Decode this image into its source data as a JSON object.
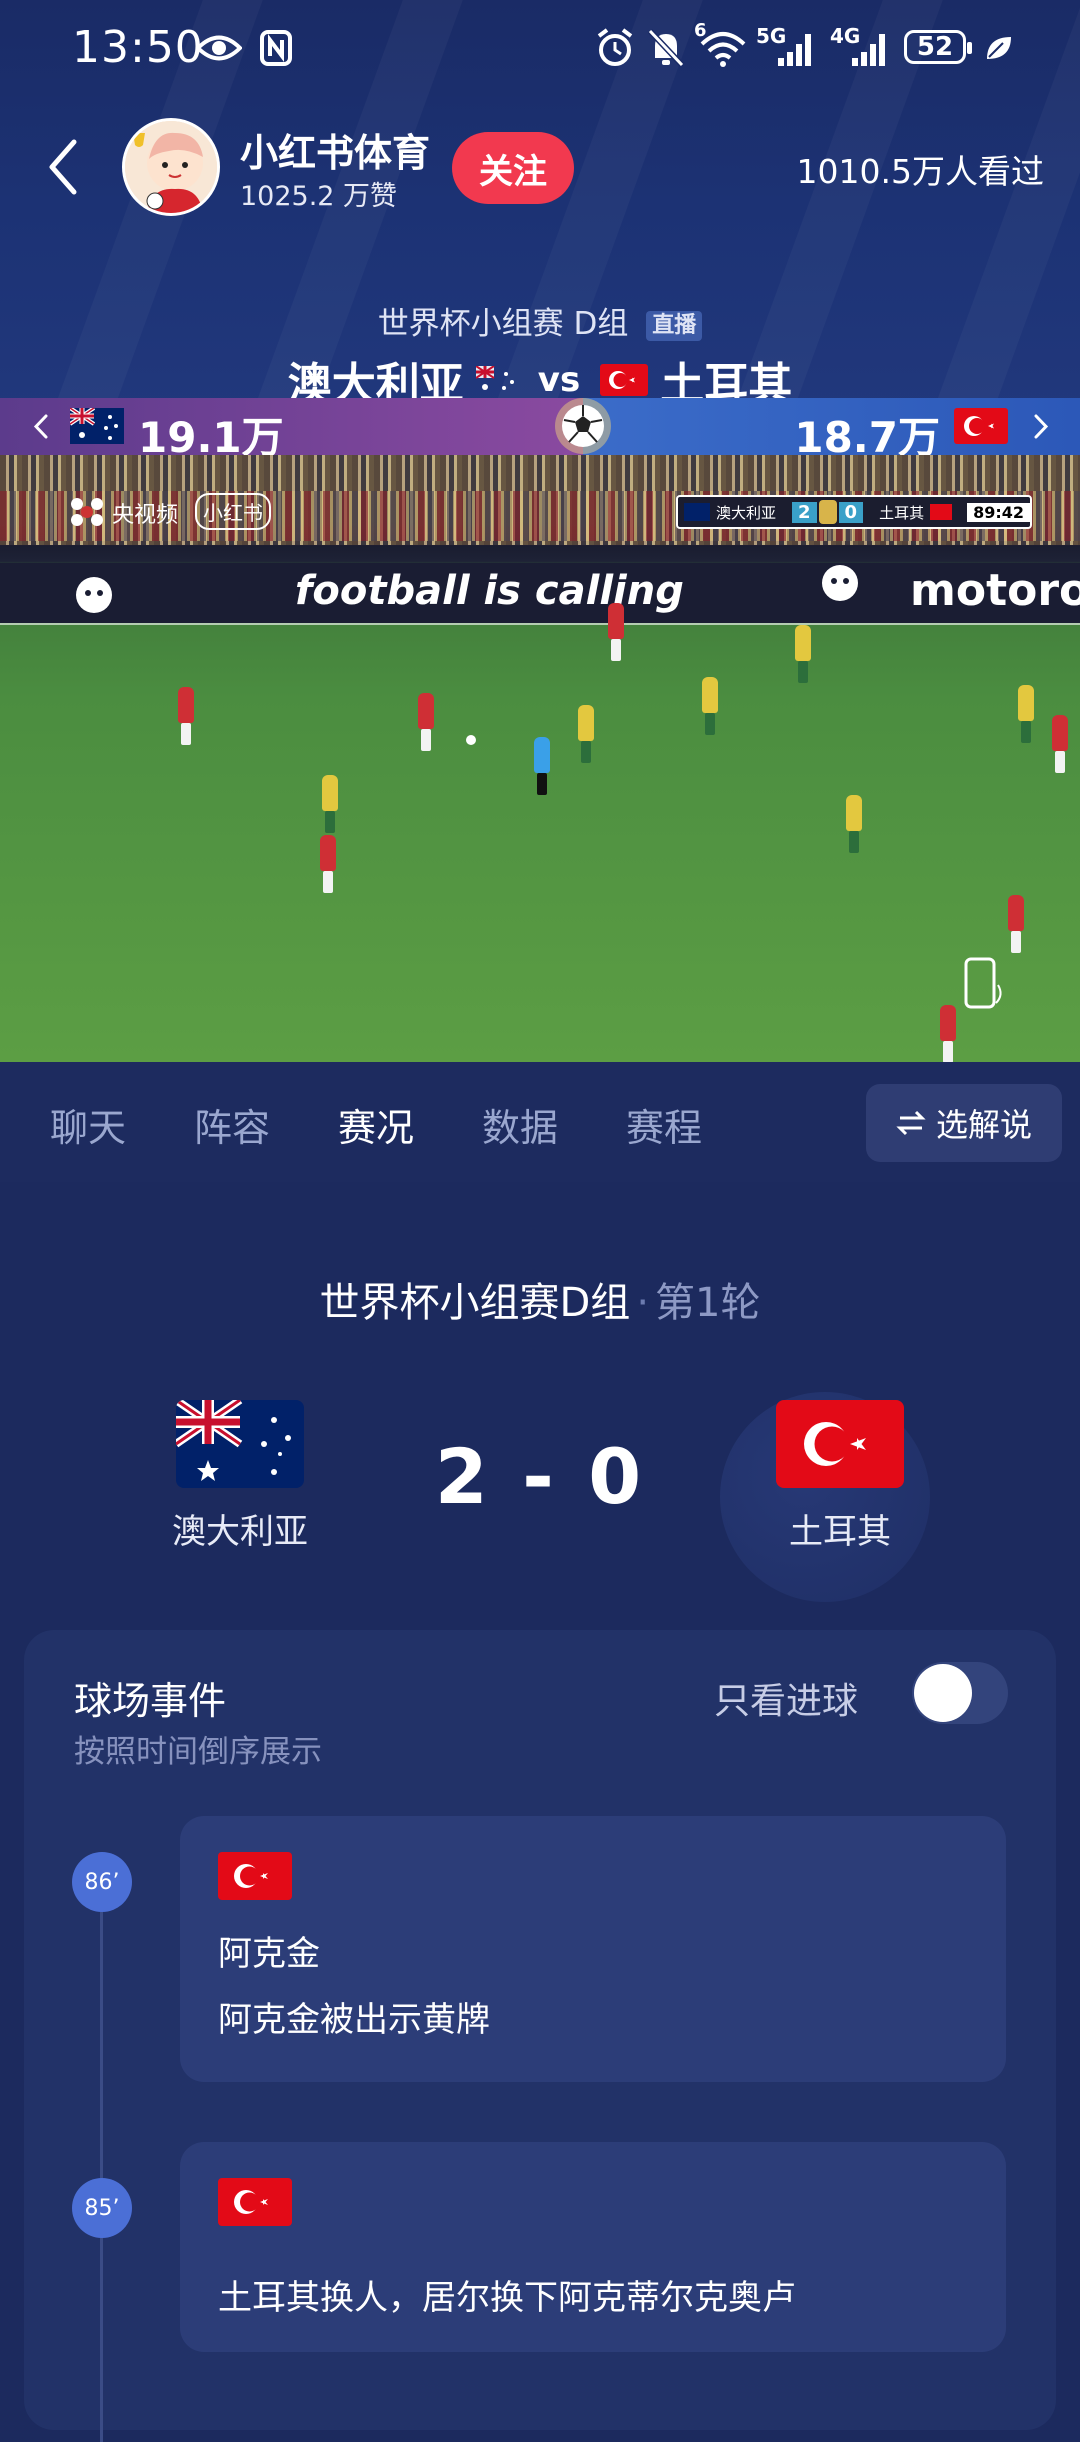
{
  "status_bar": {
    "time": "13:50",
    "battery": "52",
    "net_5g": "5G",
    "net_4g": "4G",
    "wifi_sup": "6"
  },
  "header": {
    "host_name": "小红书体育",
    "host_likes": "1025.2 万赞",
    "follow_label": "关注",
    "viewers": "1010.5万人看过"
  },
  "match": {
    "subtitle": "世界杯小组赛 D组",
    "live_tag": "直播",
    "team_left": "澳大利亚",
    "vs": "vs",
    "team_right": "土耳其",
    "support_left": "19.1万",
    "support_right": "18.7万"
  },
  "video": {
    "watermark_cctv": "央视频",
    "watermark_xhs": "小红书",
    "ad_text": "football is calling",
    "ad_brand": "motoro",
    "scorebug": {
      "team_a": "澳大利亚",
      "score_a": "2",
      "score_b": "0",
      "team_b": "土耳其",
      "clock": "89:42"
    }
  },
  "tabs": [
    {
      "label": "聊天",
      "active": false
    },
    {
      "label": "阵容",
      "active": false
    },
    {
      "label": "赛况",
      "active": true
    },
    {
      "label": "数据",
      "active": false
    },
    {
      "label": "赛程",
      "active": false
    }
  ],
  "commentary_label": "选解说",
  "scoreboard": {
    "title": "世界杯小组赛D组",
    "round": "第1轮",
    "home": "澳大利亚",
    "away": "土耳其",
    "score": "2 - 0"
  },
  "events": {
    "title": "球场事件",
    "subtitle": "按照时间倒序展示",
    "only_goals_label": "只看进球",
    "only_goals_on": false,
    "items": [
      {
        "minute": "86’",
        "team": "土耳其",
        "player": "阿克金",
        "desc": "阿克金被出示黄牌"
      },
      {
        "minute": "85’",
        "team": "土耳其",
        "player": "",
        "desc": "土耳其换人，居尔换下阿克蒂尔克奥卢"
      }
    ]
  },
  "colors": {
    "follow": "#f2394f",
    "accent_blue": "#4b6fd6",
    "bg": "#1c2a5e",
    "turkey_red": "#e30a17"
  }
}
